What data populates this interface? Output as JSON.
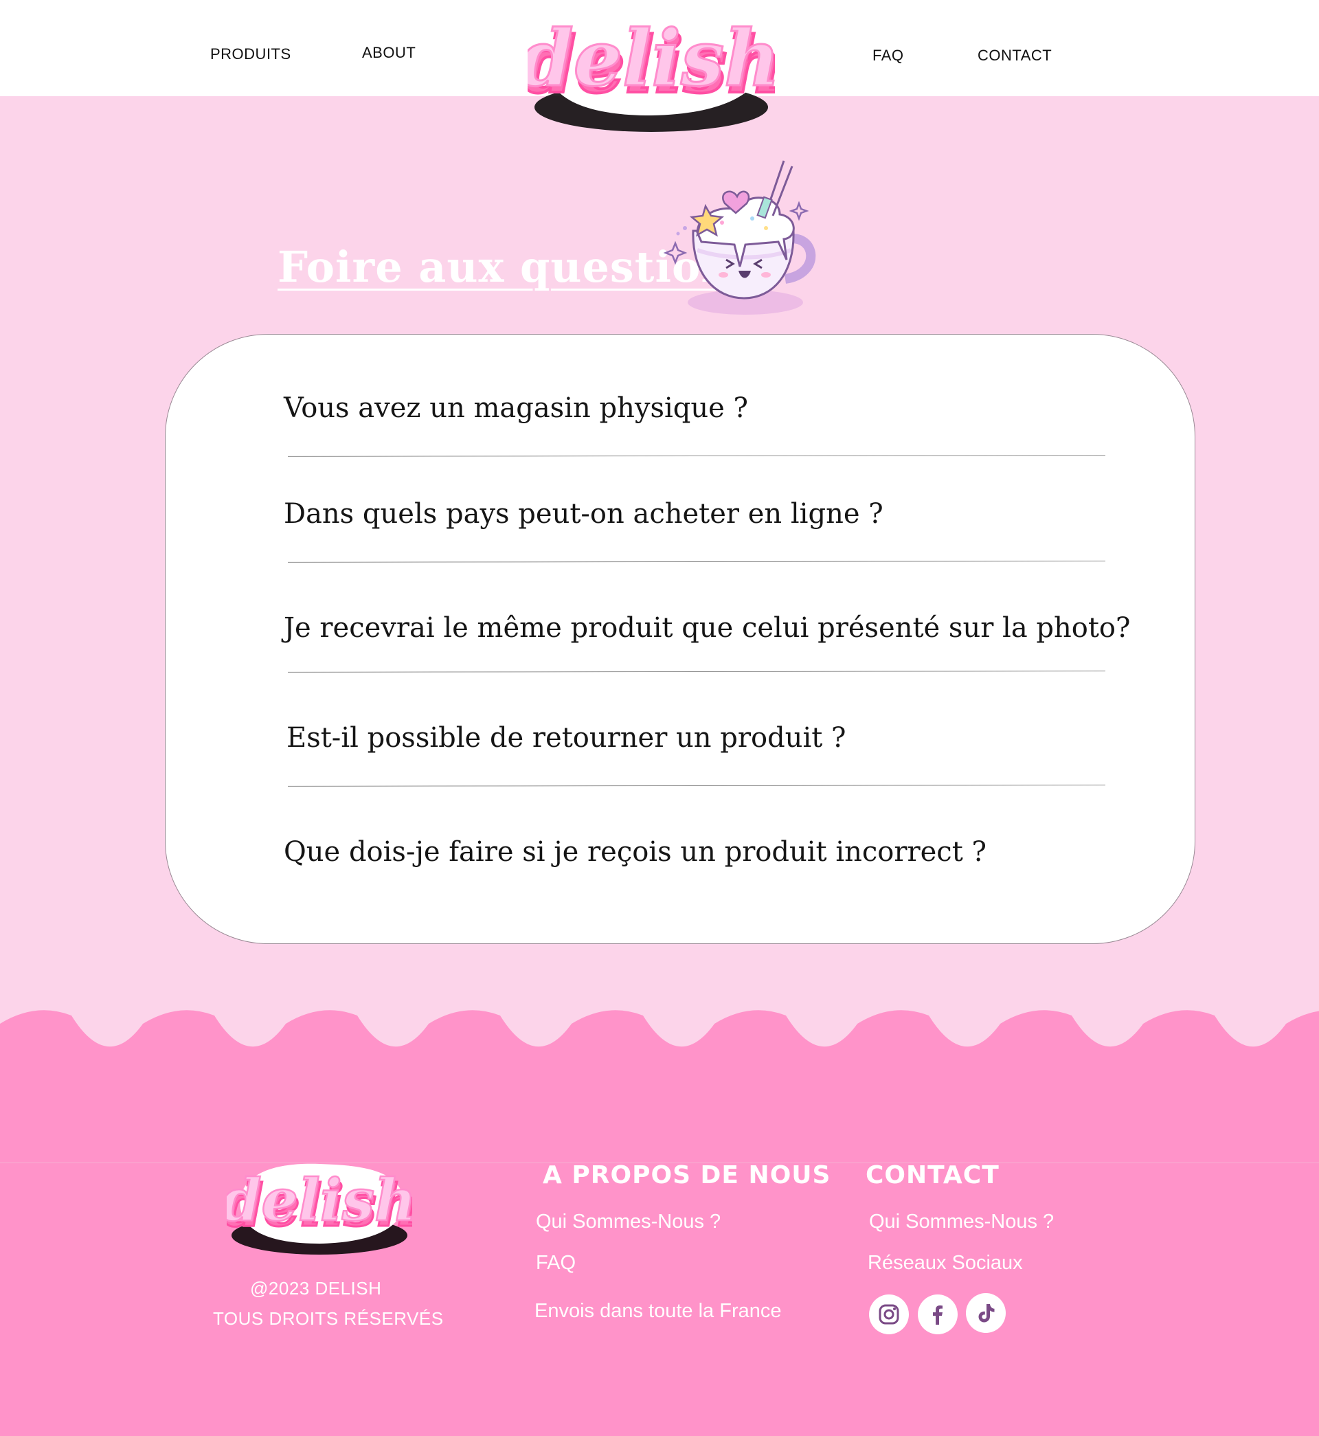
{
  "header": {
    "nav_left": [
      {
        "label": "PRODUITS"
      },
      {
        "label": "ABOUT"
      }
    ],
    "nav_right": [
      {
        "label": "FAQ"
      },
      {
        "label": "CONTACT"
      }
    ],
    "logo_text": "delish"
  },
  "faq": {
    "title": "Foire aux questions",
    "questions": [
      "Vous avez un magasin physique ?",
      "Dans quels pays peut-on acheter en ligne ?",
      "Je recevrai le même produit que celui présenté sur la photo?",
      "Est-il possible de retourner un produit ?",
      "Que dois-je faire si je reçois un produit incorrect ?"
    ]
  },
  "footer": {
    "logo_text": "delish",
    "copyright_line1": "@2023  DELISH",
    "copyright_line2": "TOUS DROITS RÉSERVÉS",
    "about": {
      "heading": "A propos de nous",
      "links": [
        "Qui Sommes-Nous ?",
        "FAQ",
        "Envois dans toute la France"
      ]
    },
    "contact": {
      "heading": "Contact",
      "links": [
        "Qui Sommes-Nous ?",
        "Réseaux Sociaux"
      ]
    },
    "social_icons": [
      "instagram-icon",
      "facebook-icon",
      "tiktok-icon"
    ]
  },
  "colors": {
    "page_bg": "#fcd4ea",
    "footer_bg": "#ff93c9",
    "accent_purple": "#7a4a86",
    "logo_pink": "#ff7fc0"
  }
}
